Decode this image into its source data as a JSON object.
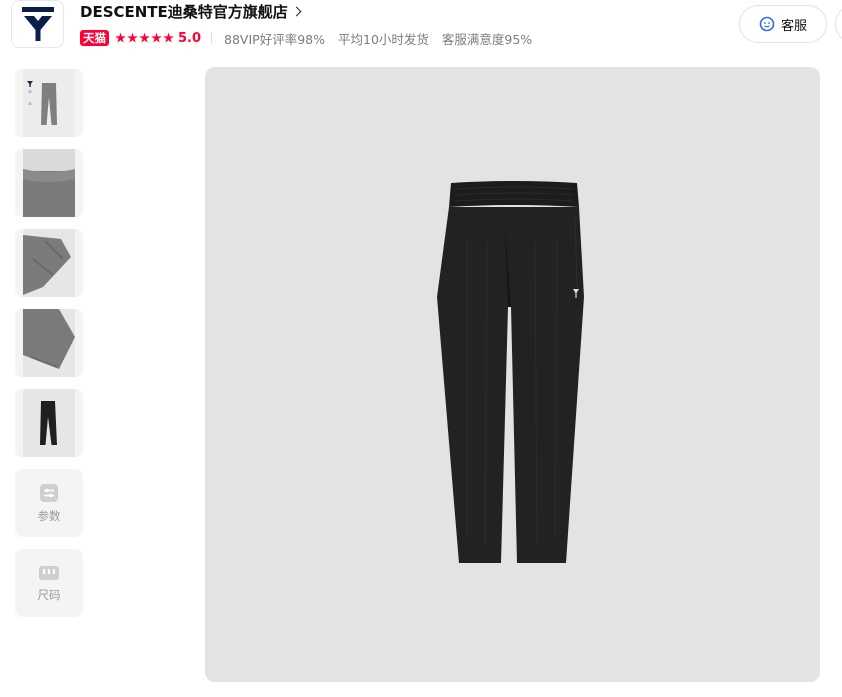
{
  "shop": {
    "name": "DESCENTE迪桑特官方旗舰店",
    "badge": "天猫",
    "rating": "5.0",
    "stats": [
      "88VIP好评率98%",
      "平均10小时发货",
      "客服满意度95%"
    ],
    "service_label": "客服",
    "logo_icon": "descente-logo-icon",
    "brand_color": "#0b1f4a",
    "tmall_color": "#ff0036"
  },
  "gallery": {
    "thumbnails": [
      {
        "name": "thumb-product-variants-icon"
      },
      {
        "name": "thumb-waistband-detail"
      },
      {
        "name": "thumb-cuff-detail"
      },
      {
        "name": "thumb-fabric-detail"
      },
      {
        "name": "thumb-black-pants"
      }
    ],
    "tools": [
      {
        "label": "参数",
        "icon": "params-icon"
      },
      {
        "label": "尺码",
        "icon": "size-icon"
      }
    ],
    "main_image": "black-pants-main-image"
  }
}
